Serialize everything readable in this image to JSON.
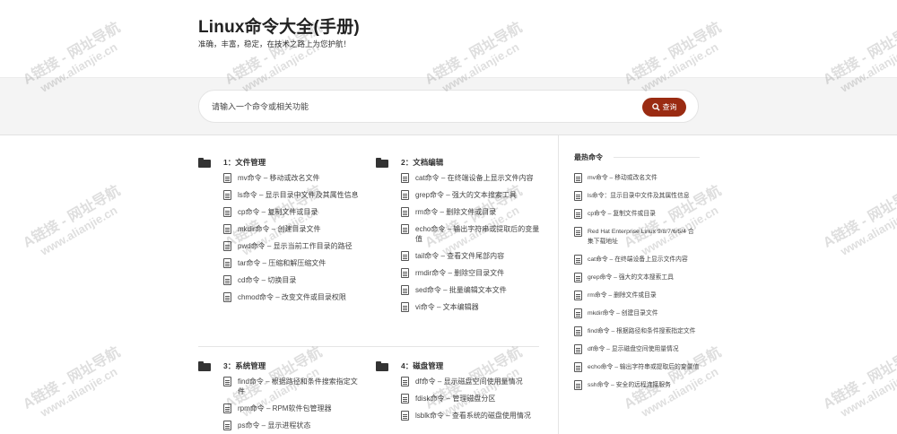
{
  "site": {
    "title": "Linux命令大全(手册)",
    "slogan": "准确，丰富，稳定，在技术之路上为您护航！"
  },
  "search": {
    "placeholder": "请输入一个命令或相关功能",
    "button_label": "查询"
  },
  "categories": [
    {
      "title": "1：文件管理",
      "items": [
        "mv命令 – 移动或改名文件",
        "ls命令 – 显示目录中文件及其属性信息",
        "cp命令 – 复制文件或目录",
        "mkdir命令 – 创建目录文件",
        "pwd命令 – 显示当前工作目录的路径",
        "tar命令 – 压缩和解压缩文件",
        "cd命令 – 切换目录",
        "chmod命令 – 改变文件或目录权限"
      ]
    },
    {
      "title": "2：文档编辑",
      "items": [
        "cat命令 – 在终端设备上显示文件内容",
        "grep命令 – 强大的文本搜索工具",
        "rm命令 – 删除文件或目录",
        "echo命令 – 输出字符串或提取后的变量值",
        "tail命令 – 查看文件尾部内容",
        "rmdir命令 – 删除空目录文件",
        "sed命令 – 批量编辑文本文件",
        "vi命令 – 文本编辑器"
      ]
    },
    {
      "title": "3：系统管理",
      "items": [
        "find命令 – 根据路径和条件搜索指定文件",
        "rpm命令 – RPM软件包管理器",
        "ps命令 – 显示进程状态"
      ]
    },
    {
      "title": "4：磁盘管理",
      "items": [
        "df命令 – 显示磁盘空间使用量情况",
        "fdisk命令 – 管理磁盘分区",
        "lsblk命令 – 查看系统的磁盘使用情况"
      ]
    }
  ],
  "sidebar": {
    "heading": "最热命令",
    "items": [
      "mv命令 – 移动或改名文件",
      "ls命令：显示目录中文件及其属性信息",
      "cp命令 – 复制文件或目录",
      "Red Hat Enterprise Linux 9/8/7/6/5/4 合集下载地址",
      "cat命令 – 在终端设备上显示文件内容",
      "grep命令 – 强大的文本搜索工具",
      "rm命令 – 删除文件或目录",
      "mkdir命令 – 创建目录文件",
      "find命令 – 根据路径和条件搜索指定文件",
      "df命令 – 显示磁盘空间使用量情况",
      "echo命令 – 输出字符串或提取后的变量值",
      "ssh命令 – 安全的远程连接服务"
    ]
  },
  "watermark": {
    "line1": "A链接 - 网址导航",
    "line2": "www.alianjie.cn"
  }
}
